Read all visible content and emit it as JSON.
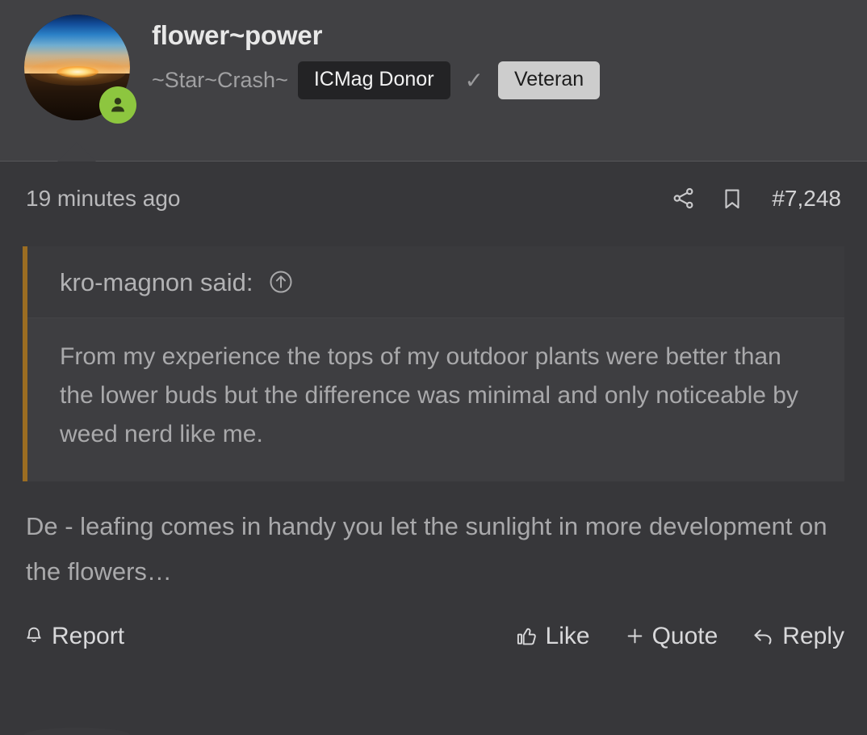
{
  "post": {
    "author": {
      "username": "flower~power",
      "user_title": "~Star~Crash~",
      "avatar_alt": "sunset-photo-avatar",
      "status_icon": "user-online-icon",
      "badges": [
        {
          "label": "ICMag Donor",
          "style": "dark"
        },
        {
          "label": "Veteran",
          "style": "light"
        }
      ],
      "verified_mark": "✓"
    },
    "meta": {
      "timestamp": "19 minutes ago",
      "post_number": "#7,248",
      "share_icon": "share-icon",
      "bookmark_icon": "bookmark-icon"
    },
    "quote": {
      "author_line": "kro-magnon said:",
      "jump_icon": "circle-arrow-up-icon",
      "text": "From my experience the tops of my outdoor plants were better than the lower buds but the difference was minimal and only noticeable by weed nerd like me.",
      "accent_color": "#9b6d22"
    },
    "message": "De - leafing comes in handy you let the sunlight in more development on the flowers…",
    "footer": {
      "report_label": "Report",
      "report_icon": "bell-icon",
      "like_label": "Like",
      "like_icon": "thumbs-up-icon",
      "quote_label": "Quote",
      "quote_icon": "plus-icon",
      "reply_label": "Reply",
      "reply_icon": "reply-arrow-icon"
    }
  },
  "theme": {
    "page_background": "#37373a",
    "header_background": "#414144",
    "quote_background": "#3e3e41",
    "accent_green": "#8dc63f",
    "badge_dark_bg": "#232325",
    "badge_light_bg": "#cdcdcd"
  }
}
